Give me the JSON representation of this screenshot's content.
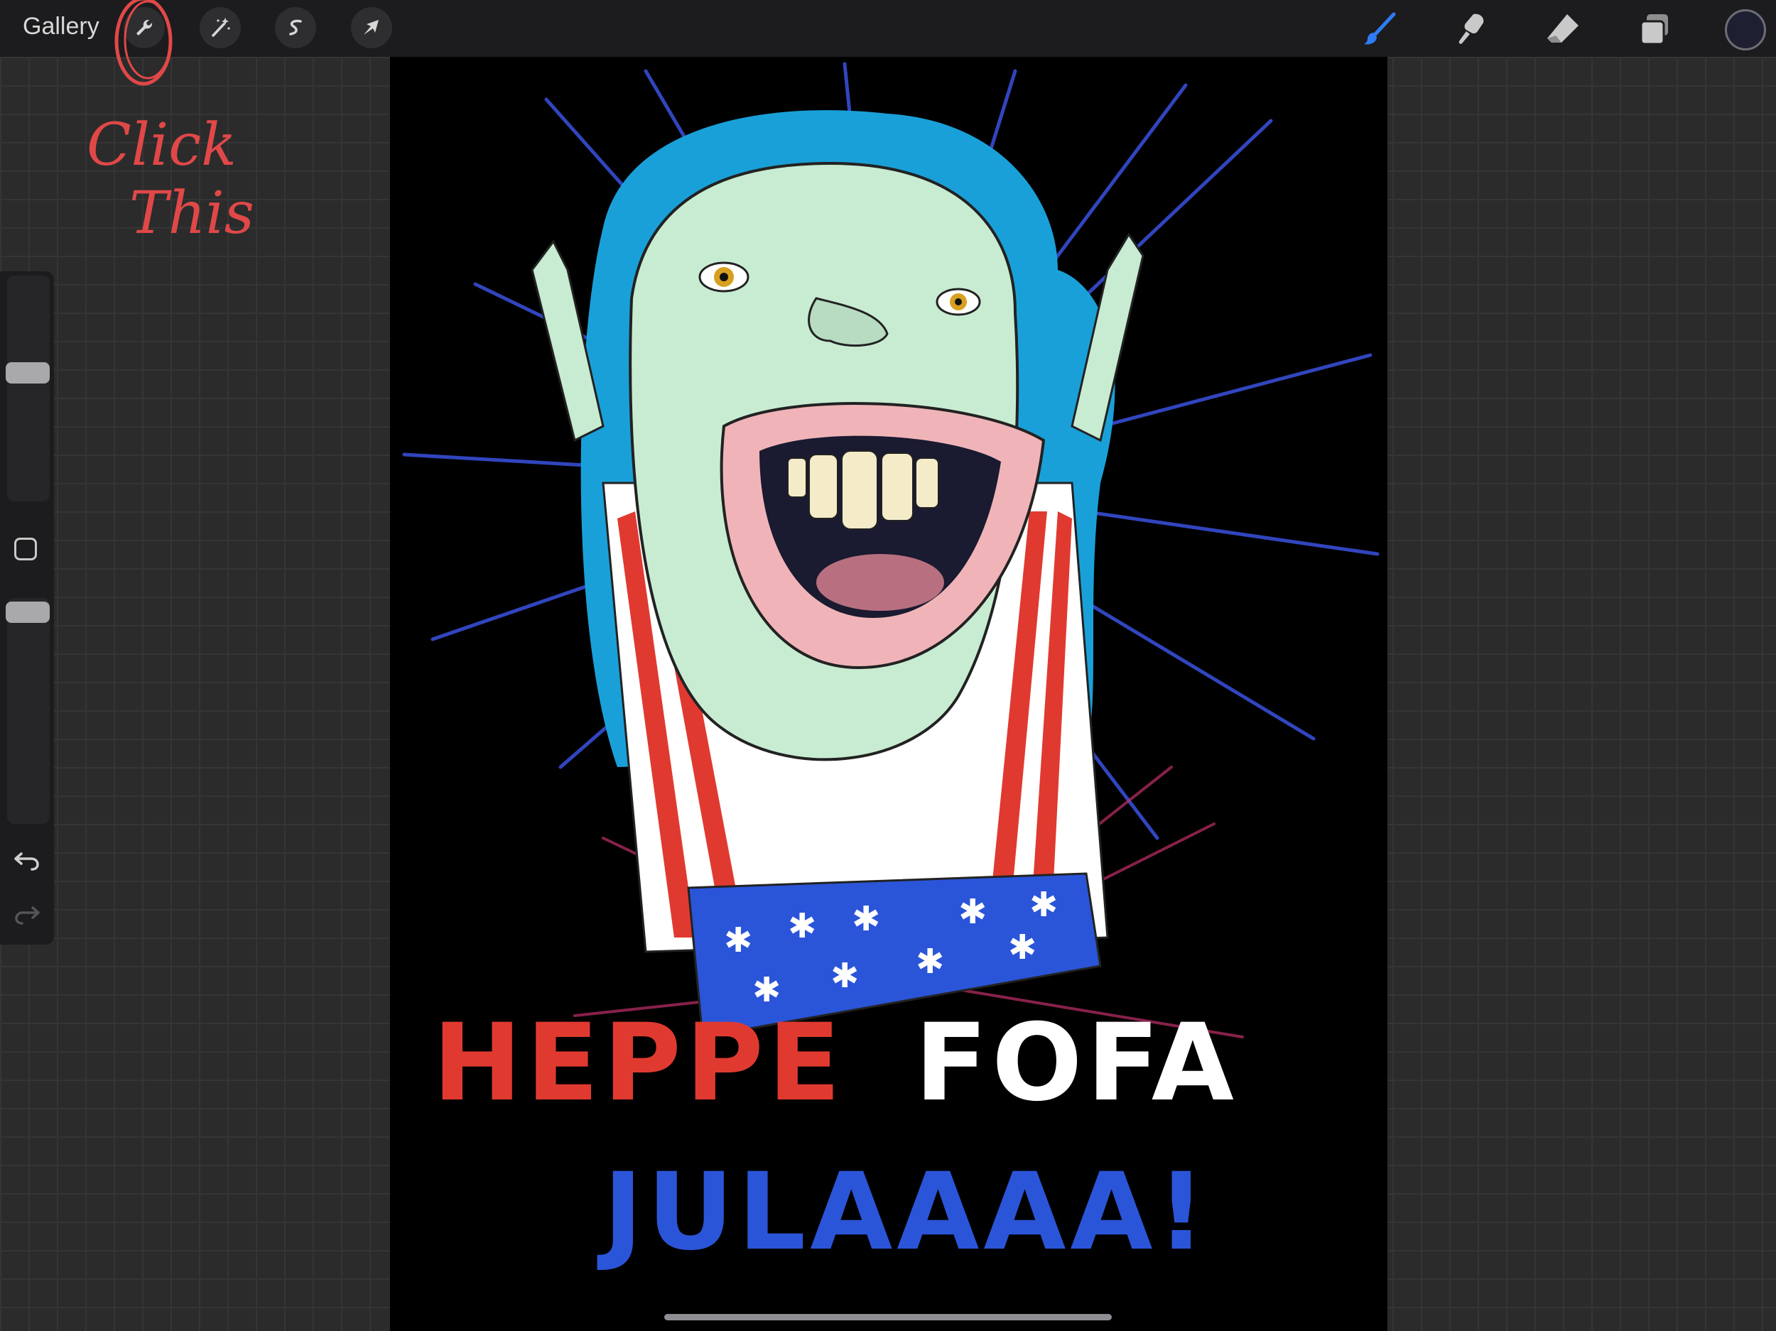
{
  "topbar": {
    "gallery_label": "Gallery",
    "left_tools": [
      "wrench-icon",
      "magic-wand-icon",
      "selection-icon",
      "transform-arrow-icon"
    ],
    "right_tools": [
      "brush-icon",
      "smudge-icon",
      "eraser-icon",
      "layers-icon"
    ],
    "active_tool": "brush",
    "active_color": "#1e2032"
  },
  "annotation": {
    "line1": "Click",
    "line2": "This",
    "color": "#e04848"
  },
  "canvas_text": {
    "line1_word1": "HEPPE",
    "line1_word2": "FOFA",
    "line2": "JULAAAA!"
  },
  "colors": {
    "hair": "#1aa0d8",
    "skin": "#c8ecd2",
    "red": "#e03a30",
    "blue": "#2b55d8",
    "accent_blue": "#2f7cf6"
  }
}
